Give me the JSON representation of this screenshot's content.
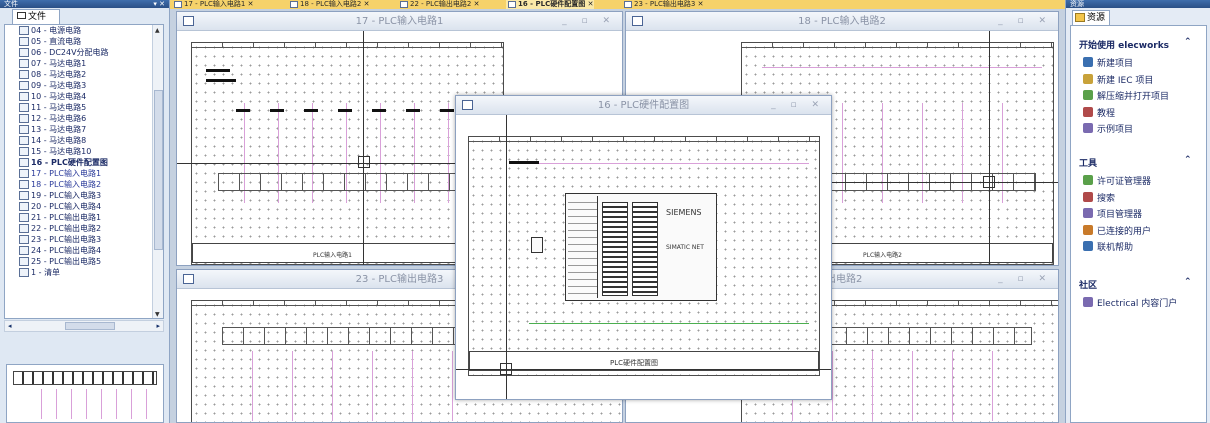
{
  "left_panel": {
    "title": "文件",
    "pin": "▾ ✕",
    "tab_label": "文件",
    "tree_items": [
      {
        "label": "04 - 电源电路",
        "state": "normal"
      },
      {
        "label": "05 - 直流电路",
        "state": "normal"
      },
      {
        "label": "06 - DC24V分配电路",
        "state": "normal"
      },
      {
        "label": "07 - 马达电路1",
        "state": "normal"
      },
      {
        "label": "08 - 马达电路2",
        "state": "normal"
      },
      {
        "label": "09 - 马达电路3",
        "state": "normal"
      },
      {
        "label": "10 - 马达电路4",
        "state": "normal"
      },
      {
        "label": "11 - 马达电路5",
        "state": "normal"
      },
      {
        "label": "12 - 马达电路6",
        "state": "normal"
      },
      {
        "label": "13 - 马达电路7",
        "state": "normal"
      },
      {
        "label": "14 - 马达电路8",
        "state": "normal"
      },
      {
        "label": "15 - 马达电路10",
        "state": "normal"
      },
      {
        "label": "16 - PLC硬件配置图",
        "state": "selected"
      },
      {
        "label": "17 - PLC输入电路1",
        "state": "blue"
      },
      {
        "label": "18 - PLC输入电路2",
        "state": "blue"
      },
      {
        "label": "19 - PLC输入电路3",
        "state": "normal"
      },
      {
        "label": "20 - PLC输入电路4",
        "state": "normal"
      },
      {
        "label": "21 - PLC输出电路1",
        "state": "normal"
      },
      {
        "label": "22 - PLC输出电路2",
        "state": "normal"
      },
      {
        "label": "23 - PLC输出电路3",
        "state": "normal"
      },
      {
        "label": "24 - PLC输出电路4",
        "state": "normal"
      },
      {
        "label": "25 - PLC输出电路5",
        "state": "normal"
      },
      {
        "label": "1 - 清单",
        "state": "normal"
      }
    ]
  },
  "doc_tabs": [
    {
      "label": "17 - PLC输入电路1 ✕",
      "active": false
    },
    {
      "label": "18 - PLC输入电路2 ✕",
      "active": false
    },
    {
      "label": "22 - PLC输出电路2 ✕",
      "active": false
    },
    {
      "label": "16 - PLC硬件配置图 ✕",
      "active": true
    },
    {
      "label": "23 - PLC输出电路3 ✕",
      "active": false
    }
  ],
  "windows": {
    "w17": {
      "title": "17 - PLC输入电路1",
      "frame_label": "PLC输入电路1"
    },
    "w18": {
      "title": "18 - PLC输入电路2",
      "frame_label": "PLC输入电路2"
    },
    "w23": {
      "title": "23 - PLC输出电路3"
    },
    "w22": {
      "title": "出电路2"
    },
    "w16": {
      "title": "16 - PLC硬件配置图",
      "frame_label": "PLC硬件配置图",
      "plc_brand": "SIEMENS",
      "plc_model": "SIMATIC NET"
    }
  },
  "window_controls": "_ ▫ ✕",
  "right_panel": {
    "title": "资源",
    "tab_label": "资源",
    "sections": [
      {
        "title": "开始使用 elecworks",
        "links": [
          "新建项目",
          "新建 IEC 项目",
          "解压缩并打开项目",
          "教程",
          "示例项目"
        ]
      },
      {
        "title": "工具",
        "links": [
          "许可证管理器",
          "搜索",
          "项目管理器",
          "已连接的用户",
          "联机帮助"
        ]
      },
      {
        "title": "社区",
        "links": [
          "Electrical 内容门户"
        ]
      }
    ],
    "chevron": "⌃"
  },
  "colors": {
    "accent_tab": "#f6d26a",
    "panel_title": "#2a4f86",
    "wire_pink": "#d9a0d9",
    "wire_green": "#4caf50"
  }
}
